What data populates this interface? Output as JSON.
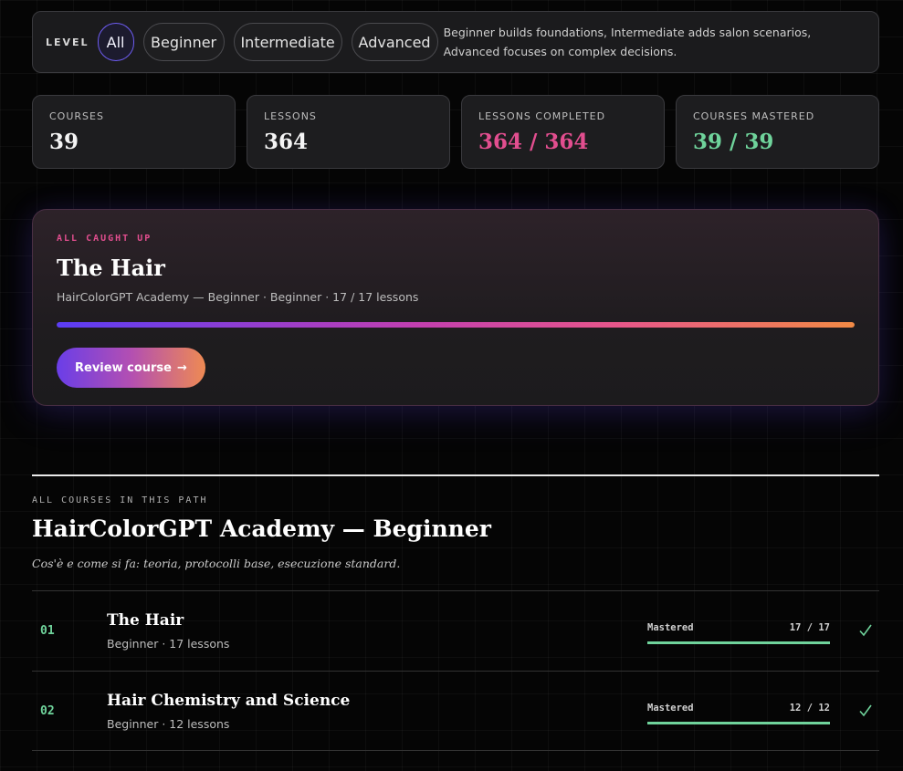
{
  "level_filter": {
    "label": "LEVEL",
    "options": [
      "All",
      "Beginner",
      "Intermediate",
      "Advanced"
    ],
    "selected": "All",
    "description": "Beginner builds foundations, Intermediate adds salon scenarios, Advanced focuses on complex decisions."
  },
  "stats": [
    {
      "label": "COURSES",
      "value": "39",
      "color": "#f5f5f5"
    },
    {
      "label": "LESSONS",
      "value": "364",
      "color": "#f5f5f5"
    },
    {
      "label": "LESSONS COMPLETED",
      "value": "364 / 364",
      "color": "#e24e8f"
    },
    {
      "label": "COURSES MASTERED",
      "value": "39 / 39",
      "color": "#6fd39b"
    }
  ],
  "continue_card": {
    "kicker": "ALL CAUGHT UP",
    "title": "The Hair",
    "subtitle": "HairColorGPT Academy — Beginner · Beginner · 17 / 17 lessons",
    "progress": 1.0,
    "button_label": "Review course",
    "button_arrow": "→"
  },
  "path": {
    "kicker": "ALL COURSES IN THIS PATH",
    "title": "HairColorGPT Academy — Beginner",
    "description": "Cos'è e come si fa: teoria, protocolli base, esecuzione standard.",
    "courses": [
      {
        "num": "01",
        "title": "The Hair",
        "meta": "Beginner · 17 lessons",
        "status": "Mastered",
        "count": "17 / 17",
        "progress": 1.0
      },
      {
        "num": "02",
        "title": "Hair Chemistry and Science",
        "meta": "Beginner · 12 lessons",
        "status": "Mastered",
        "count": "12 / 12",
        "progress": 1.0
      }
    ]
  },
  "colors": {
    "accent_pink": "#e24e8f",
    "accent_green": "#6fd39b",
    "accent_purple": "#6d5cf0"
  },
  "icons": {
    "row_complete": "check-icon"
  }
}
